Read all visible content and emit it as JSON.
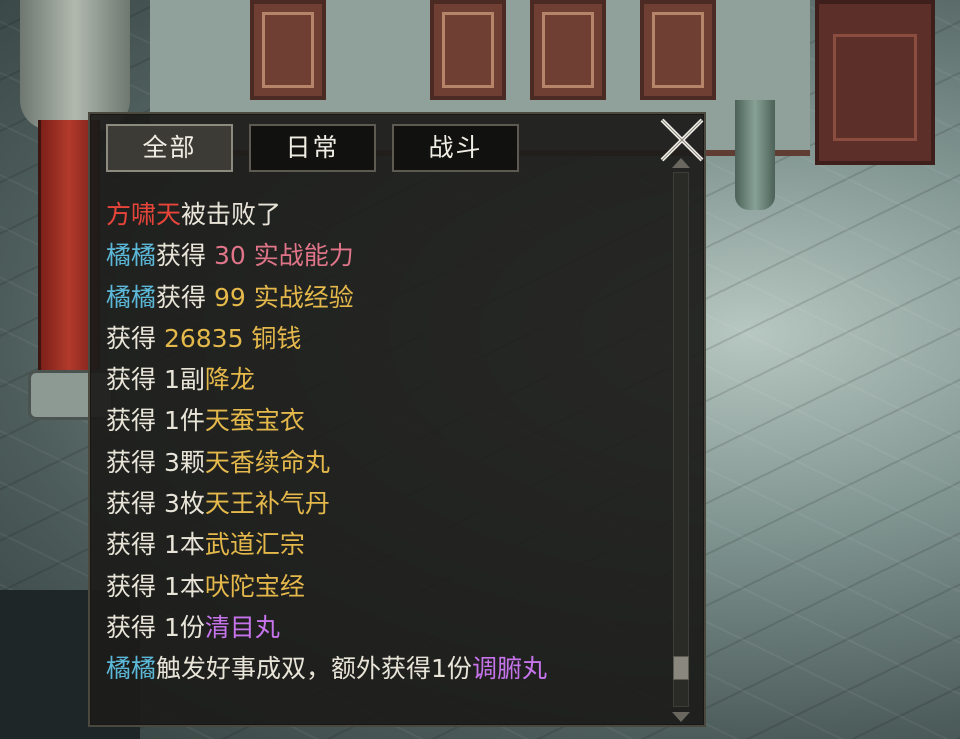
{
  "tabs": [
    {
      "label": "全部",
      "active": true
    },
    {
      "label": "日常",
      "active": false
    },
    {
      "label": "战斗",
      "active": false
    }
  ],
  "close_icon": "close-x-icon",
  "colors": {
    "white": "#e8e4d8",
    "red": "#e8453a",
    "cyan": "#5cb8d8",
    "pink": "#e07488",
    "gold": "#e4b84a",
    "purple": "#c774ec",
    "green": "#78d06a"
  },
  "messages": [
    {
      "segments": [
        {
          "text": "方啸天",
          "color": "red"
        },
        {
          "text": "被击败了",
          "color": "white"
        }
      ]
    },
    {
      "segments": [
        {
          "text": "橘橘",
          "color": "cyan"
        },
        {
          "text": "获得 ",
          "color": "white"
        },
        {
          "text": "30 实战能力",
          "color": "pink"
        }
      ]
    },
    {
      "segments": [
        {
          "text": "橘橘",
          "color": "cyan"
        },
        {
          "text": "获得 ",
          "color": "white"
        },
        {
          "text": "99 实战经验",
          "color": "gold"
        }
      ]
    },
    {
      "segments": [
        {
          "text": "获得 ",
          "color": "white"
        },
        {
          "text": "26835 铜钱",
          "color": "gold"
        }
      ]
    },
    {
      "segments": [
        {
          "text": "获得 1副",
          "color": "white"
        },
        {
          "text": "降龙",
          "color": "gold"
        }
      ]
    },
    {
      "segments": [
        {
          "text": "获得 1件",
          "color": "white"
        },
        {
          "text": "天蚕宝衣",
          "color": "gold"
        }
      ]
    },
    {
      "segments": [
        {
          "text": "获得 3颗",
          "color": "white"
        },
        {
          "text": "天香续命丸",
          "color": "gold"
        }
      ]
    },
    {
      "segments": [
        {
          "text": "获得 3枚",
          "color": "white"
        },
        {
          "text": "天王补气丹",
          "color": "gold"
        }
      ]
    },
    {
      "segments": [
        {
          "text": "获得 1本",
          "color": "white"
        },
        {
          "text": "武道汇宗",
          "color": "gold"
        }
      ]
    },
    {
      "segments": [
        {
          "text": "获得 1本",
          "color": "white"
        },
        {
          "text": "吠陀宝经",
          "color": "gold"
        }
      ]
    },
    {
      "segments": [
        {
          "text": "获得 1份",
          "color": "white"
        },
        {
          "text": "清目丸",
          "color": "purple"
        }
      ]
    },
    {
      "segments": [
        {
          "text": "橘橘",
          "color": "cyan"
        },
        {
          "text": "触发好事成双，额外获得1份",
          "color": "white"
        },
        {
          "text": "调腑丸",
          "color": "purple"
        }
      ]
    }
  ]
}
